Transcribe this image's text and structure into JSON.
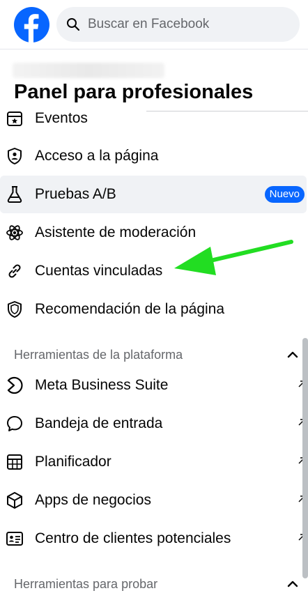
{
  "header": {
    "search_placeholder": "Buscar en Facebook",
    "brand_color": "#0866ff"
  },
  "panel": {
    "title": "Panel para profesionales"
  },
  "menu_items": [
    {
      "label": "Eventos",
      "icon": "calendar-star-icon"
    },
    {
      "label": "Acceso a la página",
      "icon": "shield-user-icon"
    },
    {
      "label": "Pruebas A/B",
      "icon": "flask-icon",
      "badge": "Nuevo"
    },
    {
      "label": "Asistente de moderación",
      "icon": "gear-atom-icon"
    },
    {
      "label": "Cuentas vinculadas",
      "icon": "link-icon"
    },
    {
      "label": "Recomendación de la página",
      "icon": "shield-icon"
    }
  ],
  "platform_tools": {
    "heading": "Herramientas de la plataforma",
    "items": [
      {
        "label": "Meta Business Suite",
        "icon": "meta-business-suite-icon"
      },
      {
        "label": "Bandeja de entrada",
        "icon": "chat-bubble-icon"
      },
      {
        "label": "Planificador",
        "icon": "planner-grid-icon"
      },
      {
        "label": "Apps de negocios",
        "icon": "cube-icon"
      },
      {
        "label": "Centro de clientes potenciales",
        "icon": "contact-card-icon"
      }
    ]
  },
  "test_tools": {
    "heading": "Herramientas para probar"
  },
  "annotation": {
    "arrow_color": "#22dd22"
  }
}
